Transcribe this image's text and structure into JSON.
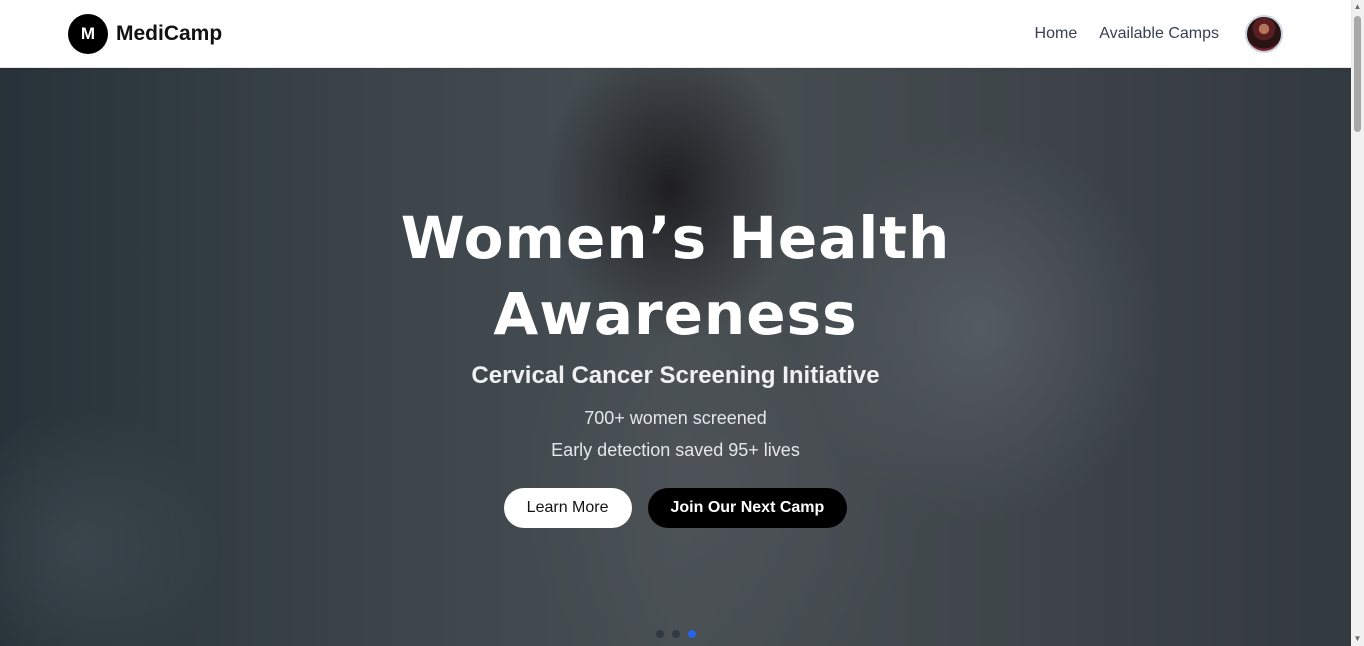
{
  "navbar": {
    "logo_letter": "M",
    "brand": "MediCamp",
    "links": [
      "Home",
      "Available Camps"
    ]
  },
  "hero": {
    "title_line1": "Women’s Health",
    "title_line2": "Awareness",
    "subtitle": "Cervical Cancer Screening Initiative",
    "stat1": "700+ women screened",
    "stat2": "Early detection saved 95+ lives",
    "learn_more": "Learn More",
    "join": "Join Our Next Camp",
    "slides_total": 3,
    "active_slide": 3
  },
  "colors": {
    "accent": "#2563eb",
    "dark_button": "#000000"
  }
}
